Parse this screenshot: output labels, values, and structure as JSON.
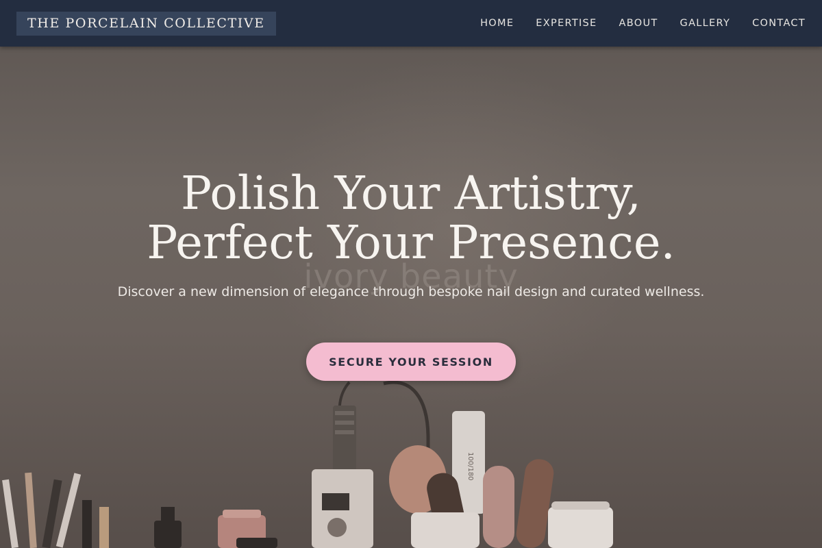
{
  "brand": {
    "name": "THE PORCELAIN COLLECTIVE"
  },
  "nav": {
    "items": [
      {
        "label": "HOME"
      },
      {
        "label": "EXPERTISE"
      },
      {
        "label": "ABOUT"
      },
      {
        "label": "GALLERY"
      },
      {
        "label": "CONTACT"
      }
    ]
  },
  "hero": {
    "headline_line1": "Polish Your Artistry,",
    "headline_line2": "Perfect Your Presence.",
    "watermark": "ivory beauty",
    "subtitle": "Discover a new dimension of elegance through bespoke nail design and curated wellness.",
    "cta_label": "SECURE YOUR SESSION",
    "file_label": "100/180"
  },
  "colors": {
    "nav_bg": "#232d40",
    "brand_bg": "#36445b",
    "cta_bg": "#f4bcd0",
    "cta_text": "#2a2d3c"
  }
}
